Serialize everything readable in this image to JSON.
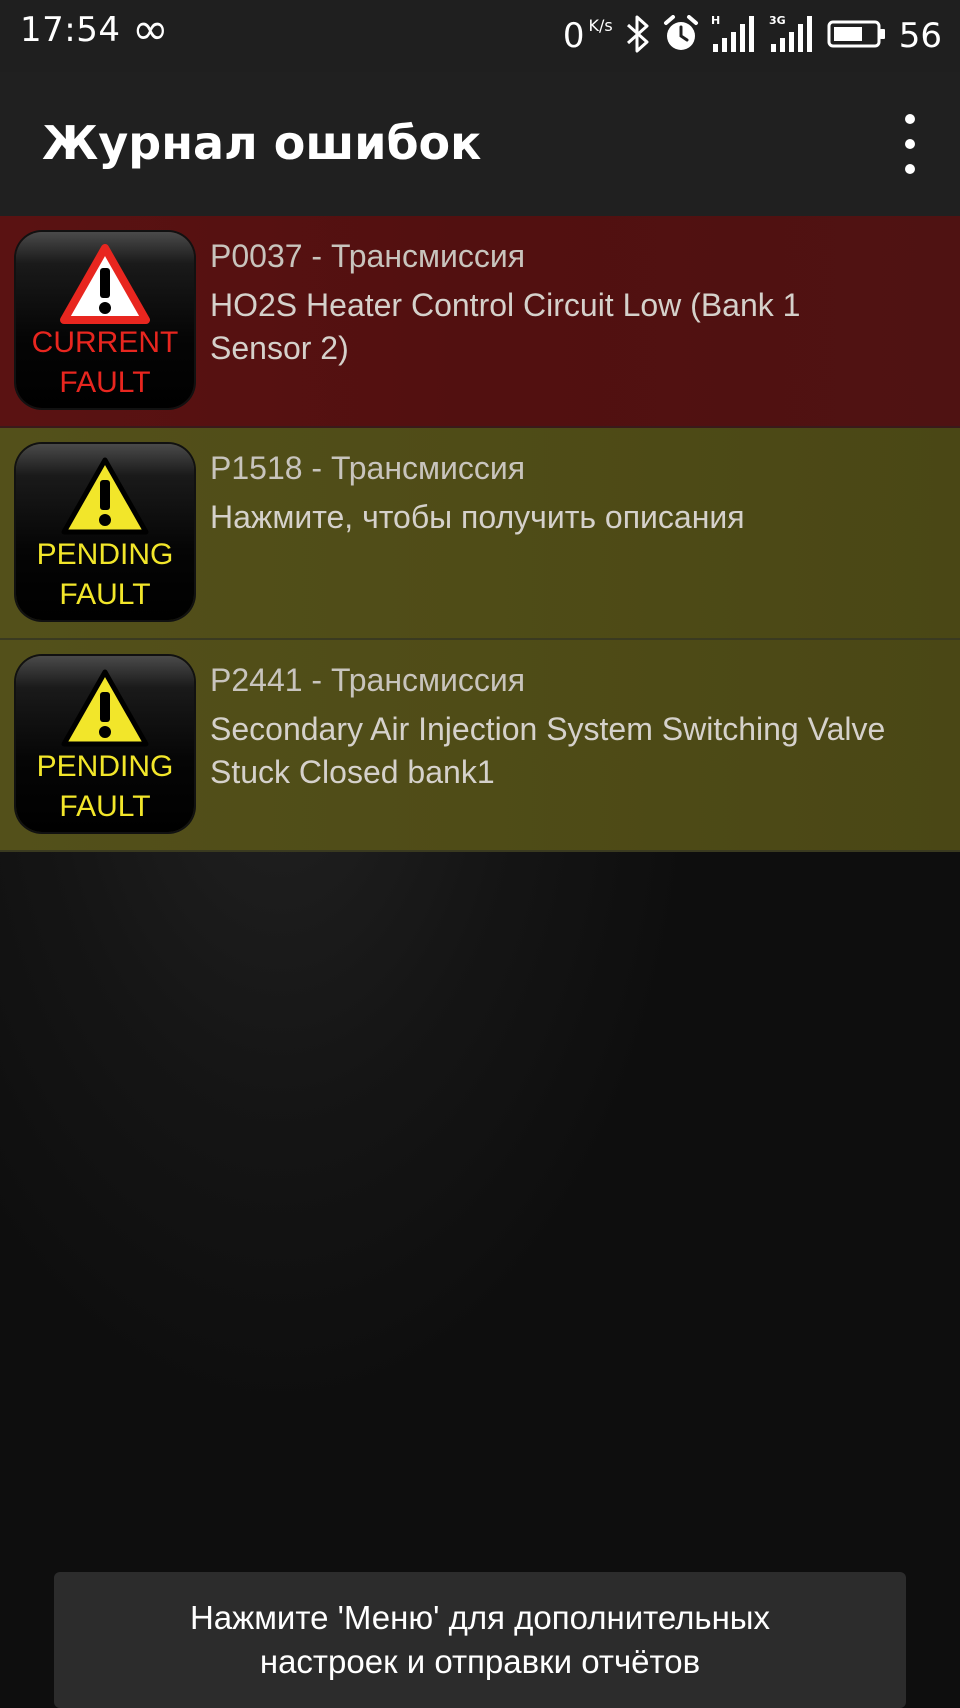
{
  "status_bar": {
    "time": "17:54",
    "net_speed": "0",
    "net_speed_unit": "K/s",
    "network_type_1": "H",
    "network_type_2": "3G",
    "battery_level": "56"
  },
  "app_bar": {
    "title": "Журнал ошибок"
  },
  "faults": [
    {
      "status": "current",
      "badge_line1": "CURRENT",
      "badge_line2": "FAULT",
      "code": "P0037 - Трансмиссия",
      "description": "HO2S Heater Control Circuit Low (Bank 1 Sensor 2)",
      "color": "#5a1212"
    },
    {
      "status": "pending",
      "badge_line1": "PENDING",
      "badge_line2": "FAULT",
      "code": "P1518 - Трансмиссия",
      "description": "Нажмите, чтобы получить описания",
      "color": "#524f19"
    },
    {
      "status": "pending",
      "badge_line1": "PENDING",
      "badge_line2": "FAULT",
      "code": "P2441 - Трансмиссия",
      "description": "Secondary Air Injection System Switching Valve Stuck Closed bank1",
      "color": "#524f19"
    }
  ],
  "toast": {
    "text": "Нажмите 'Меню' для дополнительных\nнастроек и отправки отчётов"
  },
  "icons": {
    "infinity": "infinity-icon",
    "bluetooth": "bluetooth-icon",
    "alarm": "alarm-clock-icon",
    "signal": "signal-bars-icon",
    "battery": "battery-icon",
    "menu": "overflow-menu-icon",
    "warning": "warning-triangle-icon"
  }
}
